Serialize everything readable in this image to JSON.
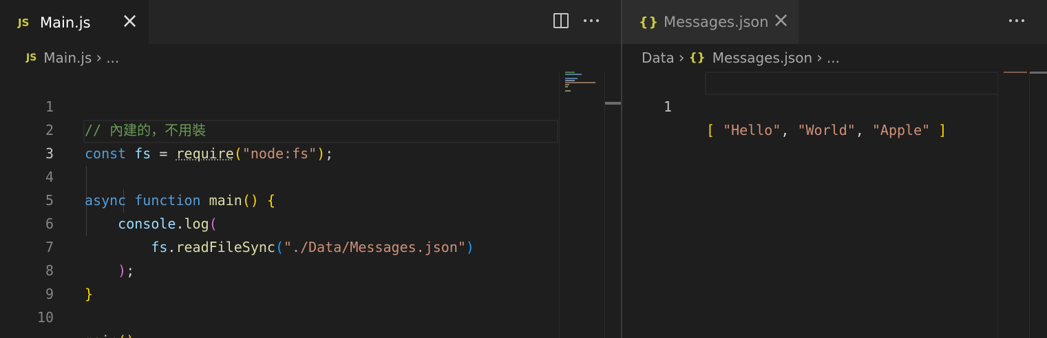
{
  "left_editor": {
    "tab": {
      "icon": "JS",
      "label": "Main.js"
    },
    "breadcrumb": {
      "icon": "JS",
      "file": "Main.js",
      "ellipsis": "..."
    },
    "lines": [
      {
        "num": "1",
        "comment": "// 內建的，不用裝"
      },
      {
        "num": "2",
        "t1": "const",
        "t2": "fs",
        "t3": " = ",
        "t4": "require",
        "t5": "(",
        "t6": "\"node:fs\"",
        "t7": ")",
        "t8": ";"
      },
      {
        "num": "3"
      },
      {
        "num": "4",
        "t1": "async",
        "t2": "function",
        "t3": "main",
        "t4": "()",
        "t5": "{"
      },
      {
        "num": "5",
        "t1": "console",
        "t2": ".",
        "t3": "log",
        "t4": "("
      },
      {
        "num": "6",
        "t1": "fs",
        "t2": ".",
        "t3": "readFileSync",
        "t4": "(",
        "t5": "\"./Data/Messages.json\"",
        "t6": ")"
      },
      {
        "num": "7",
        "t1": ")",
        "t2": ";"
      },
      {
        "num": "8",
        "t1": "}"
      },
      {
        "num": "9"
      },
      {
        "num": "10",
        "t1": "main",
        "t2": "()",
        "t3": ";"
      }
    ]
  },
  "right_editor": {
    "tab": {
      "icon": "{}",
      "label": "Messages.json"
    },
    "breadcrumb": {
      "folder": "Data",
      "icon": "{}",
      "file": "Messages.json",
      "ellipsis": "..."
    },
    "lines": [
      {
        "num": "1",
        "t1": "[",
        "t2": "\"Hello\"",
        "t3": ", ",
        "t4": "\"World\"",
        "t5": ", ",
        "t6": "\"Apple\"",
        "t7": "]"
      }
    ]
  },
  "icons": {
    "close": "close-icon",
    "split": "split-editor-icon",
    "more": "more-actions-icon"
  },
  "colors": {
    "background": "#1e1e1e",
    "keyword": "#569cd6",
    "string": "#ce9178",
    "comment": "#6a9955",
    "function": "#dcdcaa",
    "variable": "#9cdcfe",
    "bracket_gold": "#ffd700",
    "bracket_purple": "#da70d6",
    "bracket_blue": "#179fff"
  }
}
